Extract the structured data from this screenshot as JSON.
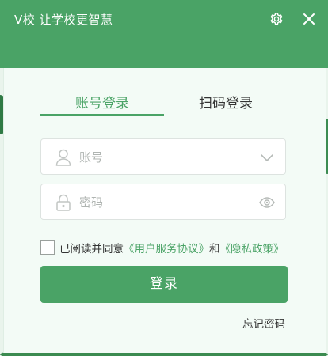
{
  "window": {
    "title": "V校 让学校更智慧",
    "settings_icon": "gear-icon",
    "close_icon": "close-icon"
  },
  "tabs": [
    {
      "label": "账号登录",
      "active": true
    },
    {
      "label": "扫码登录",
      "active": false
    }
  ],
  "form": {
    "account": {
      "placeholder": "账号",
      "value": "",
      "icon": "user-icon",
      "trailing_icon": "chevron-down-icon"
    },
    "password": {
      "placeholder": "密码",
      "value": "",
      "icon": "lock-icon",
      "trailing_icon": "eye-icon"
    }
  },
  "agreement": {
    "prefix": "已阅读并同意",
    "terms_link": "《用户服务协议》",
    "conjunction": "和",
    "privacy_link": "《隐私政策》",
    "checked": false
  },
  "login_button": "登录",
  "forgot_password": "忘记密码",
  "colors": {
    "accent": "#4aa366",
    "background": "#f3fbf6"
  }
}
